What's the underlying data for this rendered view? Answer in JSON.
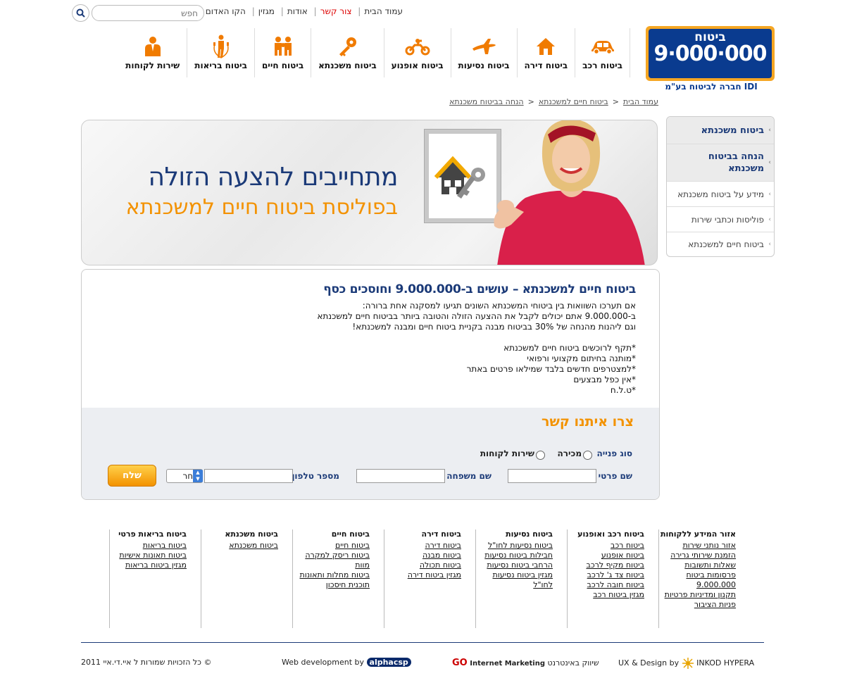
{
  "search": {
    "placeholder": "חפש"
  },
  "top_links": [
    {
      "label": "עמוד הבית",
      "color": "normal"
    },
    {
      "label": "צור קשר",
      "color": "red"
    },
    {
      "label": "אודות",
      "color": "normal"
    },
    {
      "label": "מגזין",
      "color": "normal"
    },
    {
      "label": "הקו האדום",
      "color": "normal"
    }
  ],
  "logo": {
    "line1": "ביטוח",
    "line2": "9·000·000",
    "tagline": "IDI חברה לביטוח בע\"מ"
  },
  "nav": [
    {
      "label": "ביטוח רכב",
      "icon": "car-icon"
    },
    {
      "label": "ביטוח דירה",
      "icon": "house-icon"
    },
    {
      "label": "ביטוח נסיעות",
      "icon": "airplane-icon"
    },
    {
      "label": "ביטוח אופנוע",
      "icon": "motorcycle-icon"
    },
    {
      "label": "ביטוח משכנתא",
      "icon": "key-icon"
    },
    {
      "label": "ביטוח חיים",
      "icon": "family-icon"
    },
    {
      "label": "ביטוח בריאות",
      "icon": "jump-rope-icon"
    },
    {
      "label": "שירות לקוחות",
      "icon": "agent-icon"
    }
  ],
  "breadcrumb": [
    "עמוד הבית",
    "ביטוח חיים למשכנתא",
    "הנחה בביטוח משכנתא"
  ],
  "banner": {
    "line1": "מתחייבים להצעה הזולה",
    "line2": "בפוליסת ביטוח חיים למשכנתא"
  },
  "side_menu": [
    {
      "label": "ביטוח משכנתא",
      "type": "main"
    },
    {
      "label": "הנחה בביטוח משכנתא",
      "type": "main"
    },
    {
      "label": "מידע על ביטוח משכנתא",
      "type": "sub"
    },
    {
      "label": "פוליסות וכתבי שירות",
      "type": "sub"
    },
    {
      "label": "ביטוח חיים למשכנתא",
      "type": "sub"
    }
  ],
  "content": {
    "title": "ביטוח חיים למשכנתא – עושים ב-9.000.000 וחוסכים כסף",
    "paragraph": [
      "אם תערכו השוואות בין ביטוחי המשכנתא השונים תגיעו למסקנה אחת ברורה:",
      "ב-9.000.000 אתם יכולים לקבל את ההצעה הזולה והטובה ביותר בביטוח חיים למשכנתא",
      "וגם ליהנות מהנחה של 30% בביטוח מבנה בקניית ביטוח חיים ומבנה למשכנתא!"
    ],
    "bullets": [
      "*תקף לרוכשים ביטוח חיים למשכנתא",
      "*מותנה בחיתום מקצועי ורפואי",
      "*למצטרפים חדשים בלבד שמילאו פרטים באתר",
      "*אין כפל מבצעים",
      "*ט.ל.ח"
    ]
  },
  "form": {
    "title": "צרו איתנו קשר",
    "inquiry_label": "סוג פנייה",
    "radio_sales": "מכירה",
    "radio_service": "שירות לקוחות",
    "first_name_label": "שם פרטי",
    "last_name_label": "שם משפחה",
    "phone_label": "מספר טלפון",
    "prefix_selected": "בחר",
    "submit_label": "שלח"
  },
  "footer": {
    "columns": [
      {
        "title": "אזור המידע ללקוחות",
        "links": [
          "אזור נותני שירות",
          "הזמנת שירותי גרירה",
          "שאלות ותשובות",
          "פרסומות ביטוח",
          "9.000.000",
          "תקנון ומדיניות פרטיות",
          "פניות הציבור"
        ]
      },
      {
        "title": "ביטוח רכב ואופנוע",
        "links": [
          "ביטוח רכב",
          "ביטוח אופנוע",
          "ביטוח מקיף לרכב",
          "ביטוח צד ג' לרכב",
          "ביטוח חובה לרכב",
          "מגזין ביטוח רכב"
        ]
      },
      {
        "title": "ביטוח נסיעות",
        "links": [
          "ביטוח נסיעות לחו\"ל",
          "חבילות ביטוח נסיעות",
          "הרחבי ביטוח נסיעות",
          "מגזין ביטוח נסיעות",
          "לחו\"ל"
        ]
      },
      {
        "title": "ביטוח דירה",
        "links": [
          "ביטוח דירה",
          "ביטוח מבנה",
          "ביטוח תכולה",
          "מגזין ביטוח דירה"
        ]
      },
      {
        "title": "ביטוח חיים",
        "links": [
          "ביטוח חיים",
          "ביטוח ריסק למקרה",
          "מוות",
          "ביטוח מחלות ותאונות",
          "תוכנית חיסכון"
        ]
      },
      {
        "title": "ביטוח משכנתא",
        "links": [
          "ביטוח משכנתא"
        ]
      },
      {
        "title": "ביטוח בריאות פרטי",
        "links": [
          "ביטוח בריאות",
          "ביטוח תאונות אישיות",
          "מגזין ביטוח בריאות"
        ]
      }
    ],
    "credit_design_label": "UX & Design by",
    "credit_design_names": "INKOD HYPERA",
    "credit_marketing_label": "שיווק באינטרנט",
    "credit_marketing_go": "GO",
    "credit_marketing_name": "Internet Marketing",
    "credit_dev_label": "Web development by",
    "credit_dev_name": "alphacsp",
    "copyright": "© כל הזכויות שמורות ל איי.די.איי 2011"
  },
  "colors": {
    "brand_blue": "#1b3a78",
    "logo_blue": "#0a3b8f",
    "accent_orange": "#f39200",
    "contact_red": "#dd0000"
  }
}
